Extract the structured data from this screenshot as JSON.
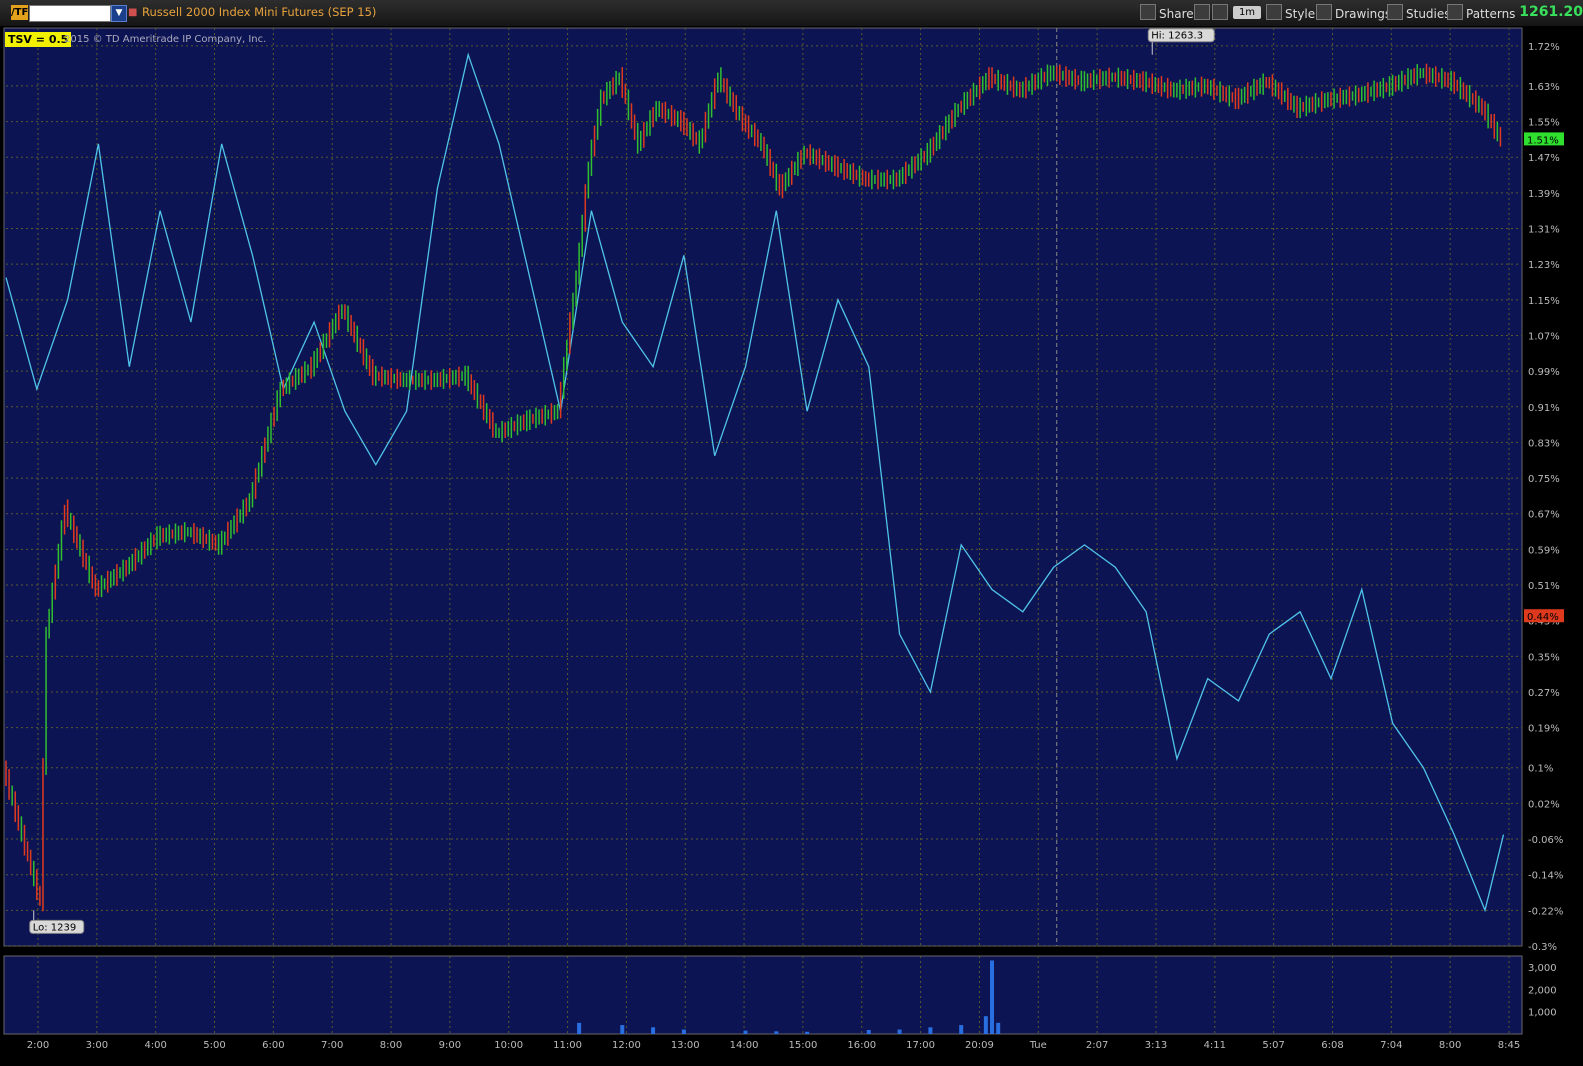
{
  "toolbar": {
    "symbol_badge": "/TF",
    "symbol_input": "",
    "instrument_title": "Russell 2000 Index Mini Futures (SEP 15)",
    "share_label": "Share",
    "timeframe": "1m",
    "style_label": "Style",
    "drawings_label": "Drawings",
    "studies_label": "Studies",
    "patterns_label": "Patterns",
    "last_price": "1261.20"
  },
  "overlay": {
    "study_label": "TSV",
    "study_value": "= 0.5",
    "copyright": "2015 © TD Ameritrade IP Company, Inc.",
    "hi_label": "Hi: 1263.3",
    "lo_label": "Lo: 1239",
    "price_marker": "1.51%",
    "tsv_marker": "0.44%"
  },
  "colors": {
    "background": "#0d1454",
    "grid": "#5a5a2a",
    "up": "#2fbf2f",
    "down": "#e03a1e",
    "tsv_line": "#4fc3e8",
    "volume": "#2a6fe0"
  },
  "chart_data": {
    "type": "line",
    "title": "",
    "y_axis_labels": [
      "1.72%",
      "1.63%",
      "1.55%",
      "1.47%",
      "1.39%",
      "1.31%",
      "1.23%",
      "1.15%",
      "1.07%",
      "0.99%",
      "0.91%",
      "0.83%",
      "0.75%",
      "0.67%",
      "0.59%",
      "0.51%",
      "0.43%",
      "0.35%",
      "0.27%",
      "0.19%",
      "0.1%",
      "0.02%",
      "-0.06%",
      "-0.14%",
      "-0.22%",
      "-0.3%"
    ],
    "x_axis_labels": [
      "2:00",
      "3:00",
      "4:00",
      "5:00",
      "6:00",
      "7:00",
      "8:00",
      "9:00",
      "10:00",
      "11:00",
      "12:00",
      "13:00",
      "14:00",
      "15:00",
      "16:00",
      "17:00",
      "20:09",
      "Tue",
      "2:07",
      "3:13",
      "4:11",
      "5:07",
      "6:08",
      "7:04",
      "8:00",
      "8:45"
    ],
    "volume_axis_labels": [
      "3,000",
      "2,000",
      "1,000"
    ],
    "series": [
      {
        "name": "",
        "style": "candles",
        "x": [
          0,
          0.4,
          0.6,
          0.7,
          1,
          1.5,
          2,
          2.5,
          3,
          3.5,
          4,
          4.5,
          5,
          5.5,
          6,
          6.5,
          7,
          7.5,
          8,
          8.5,
          9,
          9.3,
          9.5,
          9.7,
          10,
          10.3,
          10.6,
          11,
          11.3,
          11.6,
          12,
          12.3,
          12.6,
          13,
          13.5,
          14,
          14.5,
          15,
          15.5,
          16,
          16.5,
          17,
          17.5,
          18,
          18.5,
          19,
          19.5,
          20,
          20.5,
          21,
          21.5,
          22,
          22.5,
          23,
          23.5,
          24,
          24.3
        ],
        "y": [
          0.1,
          -0.1,
          -0.2,
          0.4,
          0.68,
          0.5,
          0.55,
          0.62,
          0.63,
          0.6,
          0.7,
          0.95,
          1.0,
          1.13,
          0.98,
          0.97,
          0.97,
          0.98,
          0.85,
          0.88,
          0.9,
          1.2,
          1.45,
          1.6,
          1.65,
          1.5,
          1.58,
          1.55,
          1.5,
          1.65,
          1.55,
          1.5,
          1.4,
          1.48,
          1.45,
          1.42,
          1.42,
          1.48,
          1.58,
          1.65,
          1.62,
          1.66,
          1.64,
          1.65,
          1.64,
          1.62,
          1.63,
          1.6,
          1.64,
          1.58,
          1.6,
          1.61,
          1.63,
          1.66,
          1.64,
          1.58,
          1.51
        ]
      },
      {
        "name": "TSV",
        "style": "line",
        "x": [
          0,
          0.5,
          1,
          1.5,
          2,
          2.5,
          3,
          3.5,
          4,
          4.5,
          5,
          5.5,
          6,
          6.5,
          7,
          7.5,
          8,
          8.5,
          9,
          9.5,
          10,
          10.5,
          11,
          11.5,
          12,
          12.5,
          13,
          13.5,
          14,
          14.5,
          15,
          15.5,
          16,
          16.5,
          17,
          17.5,
          18,
          18.5,
          19,
          19.5,
          20,
          20.5,
          21,
          21.5,
          22,
          22.5,
          23,
          23.5,
          24,
          24.3
        ],
        "y": [
          1.2,
          0.95,
          1.15,
          1.5,
          1.0,
          1.35,
          1.1,
          1.5,
          1.25,
          0.95,
          1.1,
          0.9,
          0.78,
          0.9,
          1.4,
          1.7,
          1.5,
          1.2,
          0.9,
          1.35,
          1.1,
          1.0,
          1.25,
          0.8,
          1.0,
          1.35,
          0.9,
          1.15,
          1.0,
          0.4,
          0.27,
          0.6,
          0.5,
          0.45,
          0.55,
          0.6,
          0.55,
          0.45,
          0.12,
          0.3,
          0.25,
          0.4,
          0.45,
          0.3,
          0.5,
          0.2,
          0.1,
          -0.05,
          -0.22,
          -0.05
        ]
      }
    ],
    "volume": {
      "x": [
        9.3,
        10,
        10.5,
        11,
        12,
        12.5,
        13,
        14,
        14.5,
        15,
        15.5,
        15.9,
        16,
        16.1
      ],
      "values": [
        500,
        400,
        300,
        200,
        150,
        120,
        100,
        180,
        200,
        300,
        400,
        800,
        3300,
        500
      ],
      "ylim": [
        0,
        3500
      ]
    },
    "annotations": [
      "Hi: 1263.3",
      "Lo: 1239"
    ],
    "ylim": [
      -0.3,
      1.76
    ],
    "grid": true,
    "legend": "none"
  }
}
